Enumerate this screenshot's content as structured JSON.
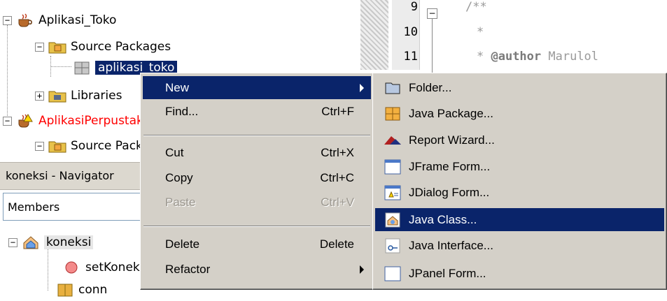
{
  "project_tree": {
    "items": [
      {
        "label": "Aplikasi_Toko",
        "expander": "−"
      },
      {
        "label": "Source Packages",
        "expander": "−"
      },
      {
        "label": "aplikasi_toko"
      },
      {
        "label": "Libraries",
        "expander": "+"
      },
      {
        "label": "AplikasiPerpustakaan",
        "expander": "−"
      },
      {
        "label": "Source Packages",
        "expander": "−"
      }
    ]
  },
  "editor": {
    "lines": [
      {
        "number": "9",
        "text": "/**",
        "keyword": ""
      },
      {
        "number": "10",
        "text": "*",
        "keyword": ""
      },
      {
        "number": "11",
        "text": "* ",
        "keyword": "@author",
        "rest": " Marulol"
      }
    ]
  },
  "navigator": {
    "title": "koneksi - Navigator",
    "filter_value": "Members",
    "items": [
      {
        "label": "koneksi",
        "expander": "−"
      },
      {
        "label": "setKoneksi"
      },
      {
        "label": "conn"
      }
    ]
  },
  "context_menu": {
    "items": [
      {
        "label": "New",
        "shortcut": ""
      },
      {
        "label": "Find...",
        "shortcut": "Ctrl+F"
      },
      {
        "label": "Cut",
        "shortcut": "Ctrl+X"
      },
      {
        "label": "Copy",
        "shortcut": "Ctrl+C"
      },
      {
        "label": "Paste",
        "shortcut": "Ctrl+V"
      },
      {
        "label": "Delete",
        "shortcut": "Delete"
      },
      {
        "label": "Refactor",
        "shortcut": ""
      }
    ]
  },
  "submenu": {
    "items": [
      {
        "label": "Folder...",
        "icon": "folder-icon"
      },
      {
        "label": "Java Package...",
        "icon": "java-package-icon"
      },
      {
        "label": "Report Wizard...",
        "icon": "report-wizard-icon"
      },
      {
        "label": "JFrame Form...",
        "icon": "jframe-form-icon"
      },
      {
        "label": "JDialog Form...",
        "icon": "jdialog-form-icon"
      },
      {
        "label": "Java Class...",
        "icon": "java-class-icon"
      },
      {
        "label": "Java Interface...",
        "icon": "java-interface-icon"
      },
      {
        "label": "JPanel Form...",
        "icon": "jpanel-form-icon"
      }
    ]
  },
  "colors": {
    "selection": "#0a246a",
    "menu_bg": "#d4d0c8",
    "error_project": "#ff0000"
  }
}
